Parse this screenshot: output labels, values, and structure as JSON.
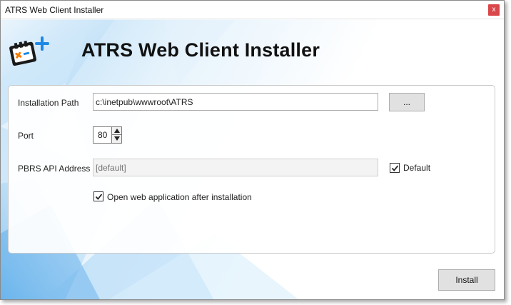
{
  "window": {
    "title": "ATRS Web Client Installer",
    "close_label": "x"
  },
  "header": {
    "title": "ATRS Web Client Installer",
    "logo_icon": "atrs-logo-icon"
  },
  "form": {
    "installation_path": {
      "label": "Installation Path",
      "value": "c:\\inetpub\\wwwroot\\ATRS"
    },
    "browse_button": {
      "label": "..."
    },
    "port": {
      "label": "Port",
      "value": "80"
    },
    "pbrs_api": {
      "label": "PBRS API Address",
      "placeholder": "[default]",
      "enabled": false
    },
    "default_checkbox": {
      "label": "Default",
      "checked": true
    },
    "open_after_install": {
      "label": "Open web application after installation",
      "checked": true
    }
  },
  "footer": {
    "install_label": "Install"
  },
  "colors": {
    "close_button": "#d9474a",
    "accent_blue": "#1e88e5",
    "logo_cross": "#f57c00"
  }
}
